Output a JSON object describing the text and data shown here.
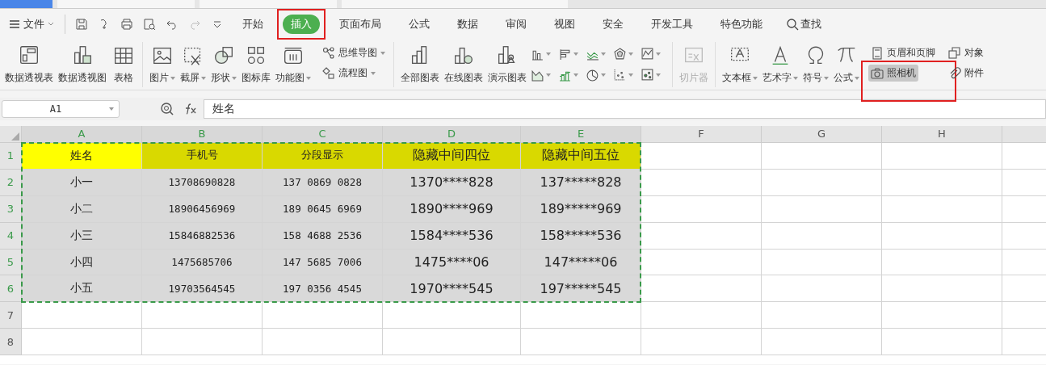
{
  "document_tabs": [
    {
      "selected": true
    },
    {
      "selected": false
    },
    {
      "selected": false
    },
    {
      "selected": false
    }
  ],
  "menu": {
    "file_label": "文件",
    "tabs": [
      {
        "label": "开始",
        "selected": false,
        "highlighted": false,
        "kind": "tab"
      },
      {
        "label": "插入",
        "selected": true,
        "highlighted": true,
        "kind": "tab"
      },
      {
        "label": "页面布局",
        "selected": false,
        "highlighted": false,
        "kind": "tab"
      },
      {
        "label": "公式",
        "selected": false,
        "highlighted": false,
        "kind": "tab"
      },
      {
        "label": "数据",
        "selected": false,
        "highlighted": false,
        "kind": "tab"
      },
      {
        "label": "审阅",
        "selected": false,
        "highlighted": false,
        "kind": "tab"
      },
      {
        "label": "视图",
        "selected": false,
        "highlighted": false,
        "kind": "tab"
      },
      {
        "label": "安全",
        "selected": false,
        "highlighted": false,
        "kind": "tab"
      },
      {
        "label": "开发工具",
        "selected": false,
        "highlighted": false,
        "kind": "tab"
      },
      {
        "label": "特色功能",
        "selected": false,
        "highlighted": false,
        "kind": "tab"
      },
      {
        "label": "查找",
        "kind": "search"
      }
    ]
  },
  "ribbon": {
    "groups": [
      {
        "items": [
          {
            "kind": "big",
            "label": "数据透视表",
            "dropdown": false,
            "disabled": false
          },
          {
            "kind": "big",
            "label": "数据透视图",
            "dropdown": false,
            "disabled": false
          },
          {
            "kind": "big",
            "label": "表格",
            "dropdown": false,
            "disabled": false
          }
        ]
      },
      {
        "items": [
          {
            "kind": "big",
            "label": "图片",
            "dropdown": true,
            "disabled": false
          },
          {
            "kind": "big",
            "label": "截屏",
            "dropdown": true,
            "disabled": false
          },
          {
            "kind": "big",
            "label": "形状",
            "dropdown": true,
            "disabled": false
          },
          {
            "kind": "big",
            "label": "图标库",
            "dropdown": false,
            "disabled": false
          },
          {
            "kind": "big",
            "label": "功能图",
            "dropdown": true,
            "disabled": false
          },
          {
            "kind": "stack",
            "items": [
              {
                "label": "思维导图",
                "dropdown": true,
                "selected": false,
                "highlighted": false
              },
              {
                "label": "流程图",
                "dropdown": true,
                "selected": false,
                "highlighted": false
              }
            ]
          }
        ]
      },
      {
        "items": [
          {
            "kind": "big",
            "label": "全部图表",
            "dropdown": false,
            "disabled": false
          },
          {
            "kind": "big",
            "label": "在线图表",
            "dropdown": false,
            "disabled": false
          },
          {
            "kind": "big",
            "label": "演示图表",
            "dropdown": false,
            "disabled": false
          },
          {
            "kind": "chart_grid"
          }
        ]
      },
      {
        "items": [
          {
            "kind": "big",
            "label": "切片器",
            "dropdown": false,
            "disabled": true
          }
        ]
      },
      {
        "items": [
          {
            "kind": "big",
            "label": "文本框",
            "dropdown": true,
            "disabled": false
          },
          {
            "kind": "big",
            "label": "艺术字",
            "dropdown": true,
            "disabled": false
          },
          {
            "kind": "big",
            "label": "符号",
            "dropdown": true,
            "disabled": false
          },
          {
            "kind": "big",
            "label": "公式",
            "dropdown": true,
            "disabled": false
          },
          {
            "kind": "stack",
            "items": [
              {
                "label": "页眉和页脚",
                "dropdown": false,
                "selected": false,
                "highlighted": false
              },
              {
                "label": "照相机",
                "dropdown": false,
                "selected": true,
                "highlighted": true
              }
            ]
          },
          {
            "kind": "stack",
            "items": [
              {
                "label": "对象",
                "dropdown": false,
                "selected": false,
                "highlighted": false
              },
              {
                "label": "附件",
                "dropdown": false,
                "selected": false,
                "highlighted": false
              }
            ]
          }
        ]
      }
    ]
  },
  "formula_bar": {
    "cell_ref": "A1",
    "value": "姓名"
  },
  "sheet": {
    "columns": [
      "A",
      "B",
      "C",
      "D",
      "E",
      "F",
      "G",
      "H"
    ],
    "copy_marquee": true,
    "rows": [
      {
        "header": "1",
        "cells": [
          {
            "text": "姓名",
            "color": "#ffff00"
          },
          {
            "text": "手机号",
            "color": "#d9d900"
          },
          {
            "text": "分段显示",
            "color": "#d9d900"
          },
          {
            "text": "隐藏中间四位",
            "color": "#d9d900"
          },
          {
            "text": "隐藏中间五位",
            "color": "#d9d900"
          }
        ]
      },
      {
        "header": "2",
        "cells": [
          {
            "text": "小一",
            "color": "#d9d9d9"
          },
          {
            "text": "13708690828",
            "color": "#d9d9d9"
          },
          {
            "text": "137 0869 0828",
            "color": "#d9d9d9"
          },
          {
            "text": "1370****828",
            "color": "#d9d9d9"
          },
          {
            "text": "137*****828",
            "color": "#d9d9d9"
          }
        ]
      },
      {
        "header": "3",
        "cells": [
          {
            "text": "小二",
            "color": "#d9d9d9"
          },
          {
            "text": "18906456969",
            "color": "#d9d9d9"
          },
          {
            "text": "189 0645 6969",
            "color": "#d9d9d9"
          },
          {
            "text": "1890****969",
            "color": "#d9d9d9"
          },
          {
            "text": "189*****969",
            "color": "#d9d9d9"
          }
        ]
      },
      {
        "header": "4",
        "cells": [
          {
            "text": "小三",
            "color": "#d9d9d9"
          },
          {
            "text": "15846882536",
            "color": "#d9d9d9"
          },
          {
            "text": "158 4688 2536",
            "color": "#d9d9d9"
          },
          {
            "text": "1584****536",
            "color": "#d9d9d9"
          },
          {
            "text": "158*****536",
            "color": "#d9d9d9"
          }
        ]
      },
      {
        "header": "5",
        "cells": [
          {
            "text": "小四",
            "color": "#d9d9d9"
          },
          {
            "text": "1475685706",
            "color": "#d9d9d9"
          },
          {
            "text": "147 5685 7006",
            "color": "#d9d9d9"
          },
          {
            "text": "1475****06",
            "color": "#d9d9d9"
          },
          {
            "text": "147*****06",
            "color": "#d9d9d9"
          }
        ]
      },
      {
        "header": "6",
        "cells": [
          {
            "text": "小五",
            "color": "#d9d9d9"
          },
          {
            "text": "19703564545",
            "color": "#d9d9d9"
          },
          {
            "text": "197 0356 4545",
            "color": "#d9d9d9"
          },
          {
            "text": "1970****545",
            "color": "#d9d9d9"
          },
          {
            "text": "197*****545",
            "color": "#d9d9d9"
          }
        ]
      },
      {
        "header": "7",
        "cells": []
      },
      {
        "header": "8",
        "cells": []
      }
    ]
  }
}
